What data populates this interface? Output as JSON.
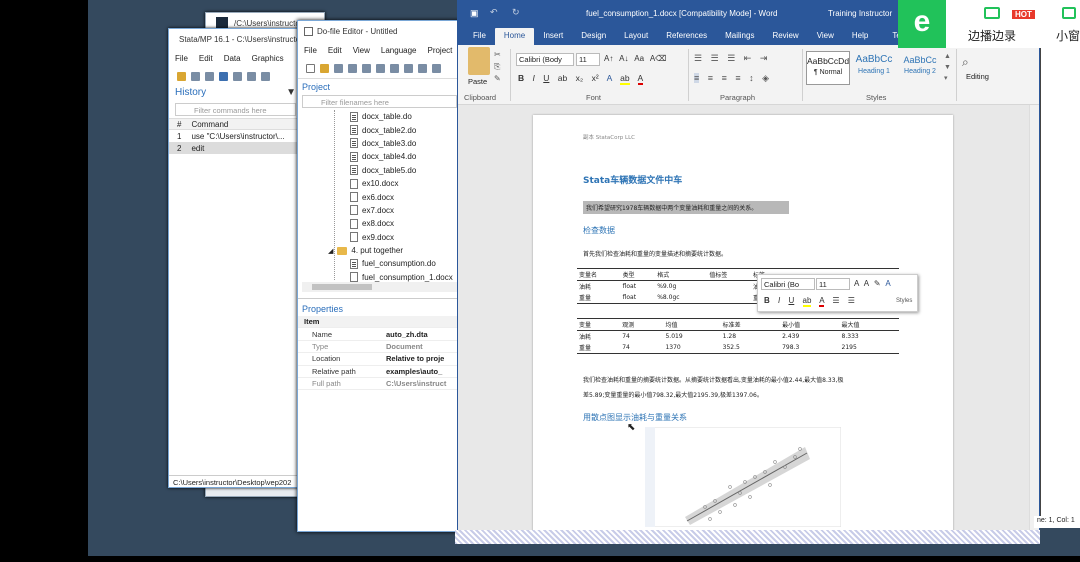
{
  "stata_back": {
    "title": "/C:\\Users\\instructor..."
  },
  "stata": {
    "title": "Stata/MP 16.1 - C:\\Users\\instructor...",
    "menu": [
      "File",
      "Edit",
      "Data",
      "Graphics"
    ],
    "history_title": "History",
    "filter_placeholder": "Filter commands here",
    "col_hash": "#",
    "col_command": "Command",
    "rows": [
      {
        "n": "1",
        "cmd": "use \"C:\\Users\\instructor\\..."
      },
      {
        "n": "2",
        "cmd": "edit"
      }
    ],
    "status": "C:\\Users\\instructor\\Desktop\\vep202"
  },
  "dofile": {
    "title": "Do-file Editor - Untitled",
    "menu": [
      "File",
      "Edit",
      "View",
      "Language",
      "Project"
    ],
    "project_label": "Project",
    "filter_placeholder": "Filter filenames here",
    "tree": [
      {
        "label": "docx_table.do",
        "type": "do"
      },
      {
        "label": "docx_table2.do",
        "type": "do"
      },
      {
        "label": "docx_table3.do",
        "type": "do"
      },
      {
        "label": "docx_table4.do",
        "type": "do"
      },
      {
        "label": "docx_table5.do",
        "type": "do"
      },
      {
        "label": "ex10.docx",
        "type": "doc"
      },
      {
        "label": "ex6.docx",
        "type": "doc"
      },
      {
        "label": "ex7.docx",
        "type": "doc"
      },
      {
        "label": "ex8.docx",
        "type": "doc"
      },
      {
        "label": "ex9.docx",
        "type": "doc"
      }
    ],
    "folder": "4. put together",
    "folder_items": [
      {
        "label": "fuel_consumption.do",
        "type": "do"
      },
      {
        "label": "fuel_consumption_1.docx",
        "type": "doc"
      }
    ],
    "properties_label": "Properties",
    "item_label": "Item",
    "props": [
      {
        "k": "Name",
        "v": "auto_zh.dta",
        "dim": false
      },
      {
        "k": "Type",
        "v": "Document",
        "dim": true
      },
      {
        "k": "Location",
        "v": "Relative to proje",
        "dim": false
      },
      {
        "k": "Relative path",
        "v": "examples\\auto_",
        "dim": false
      },
      {
        "k": "Full path",
        "v": "C:\\Users\\instruct",
        "dim": true
      }
    ]
  },
  "word": {
    "title": "fuel_consumption_1.docx [Compatibility Mode] - Word",
    "user": "Training Instructor",
    "tabs": [
      "File",
      "Home",
      "Insert",
      "Design",
      "Layout",
      "References",
      "Mailings",
      "Review",
      "View",
      "Help"
    ],
    "tell_me": "Tell me what",
    "clipboard": {
      "paste": "Paste",
      "group": "Clipboard"
    },
    "font": {
      "name": "Calibri (Body",
      "size": "11",
      "group": "Font"
    },
    "paragraph_group": "Paragraph",
    "styles": [
      {
        "sample": "AaBbCcDd",
        "label": "¶ Normal"
      },
      {
        "sample": "AaBbCc",
        "label": "Heading 1"
      },
      {
        "sample": "AaBbCc",
        "label": "Heading 2"
      }
    ],
    "styles_group": "Styles",
    "editing": "Editing",
    "doc": {
      "header": "副本 StataCorp LLC",
      "title": "Stata车辆数据文件中车",
      "intro": "我们希望研究1978车辆数据中两个变量油耗和重量之间的关系。",
      "sec1": "检查数据",
      "p1": "首先我们检查油耗和重量的变量描述和摘要统计数据。",
      "table1": {
        "headers": [
          "变量名",
          "类型",
          "格式",
          "值标签",
          "标签"
        ],
        "rows": [
          [
            "油耗",
            "float",
            "%9.0g",
            "",
            "油量消耗(公升每一百公里)"
          ],
          [
            "重量",
            "float",
            "%8.0gc",
            "",
            "重量(公斤)"
          ]
        ]
      },
      "table2": {
        "headers": [
          "变量",
          "观测",
          "均值",
          "标准差",
          "最小值",
          "最大值"
        ],
        "rows": [
          [
            "油耗",
            "74",
            "5.019",
            "1.28",
            "2.439",
            "8.333"
          ],
          [
            "重量",
            "74",
            "1370",
            "352.5",
            "798.3",
            "2195"
          ]
        ]
      },
      "p2a": "我们检查油耗和重量的摘要统计数据。从摘要统计数据看出,变量油耗的最小值2.44,最大值8.33,极",
      "p2b": "差5.89;变量重量的最小值798.32,最大值2195.39,极差1397.06。",
      "sec2": "用散点图显示油耗与重量关系"
    },
    "mini": {
      "font": "Calibri (Bo",
      "size": "11",
      "styles": "Styles"
    }
  },
  "promo": {
    "brand": "e",
    "label1": "边播边录",
    "hot": "HOT",
    "label2": "小窗"
  },
  "status_right": "ne: 1, Col: 1"
}
